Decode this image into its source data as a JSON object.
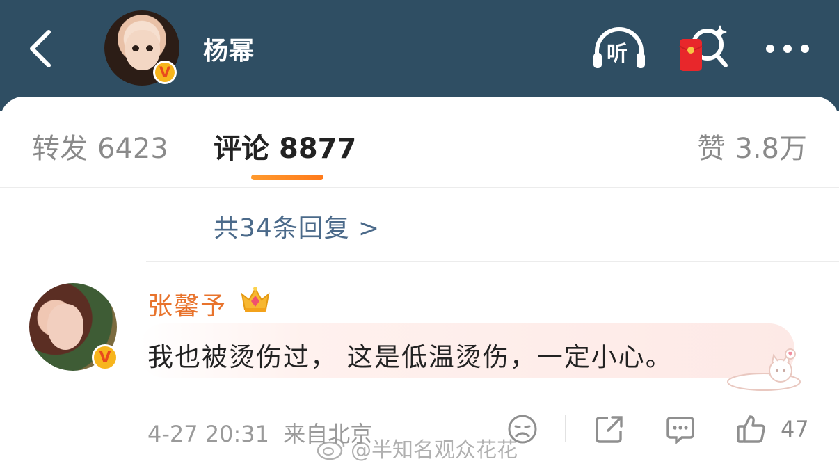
{
  "header": {
    "title": "杨幂",
    "back_icon": "chevron-left-icon",
    "listen_label": "听",
    "colors": {
      "background": "#2f4e63",
      "text": "#ffffff"
    }
  },
  "tabs": {
    "repost": {
      "label": "转发",
      "count": "6423"
    },
    "comment": {
      "label": "评论",
      "count": "8877"
    },
    "like": {
      "label": "赞",
      "count": "3.8万"
    },
    "active_color": "#ff8a26"
  },
  "replies": {
    "text": "共34条回复",
    "arrow": ">"
  },
  "comment": {
    "username": "张馨予",
    "text": "我也被烫伤过， 这是低温烫伤，一定小心。",
    "date": "4-27 20:31",
    "location": "来自北京",
    "like_count": "47",
    "username_color": "#e8732c"
  },
  "watermark": {
    "text": "@半知名观众花花"
  }
}
